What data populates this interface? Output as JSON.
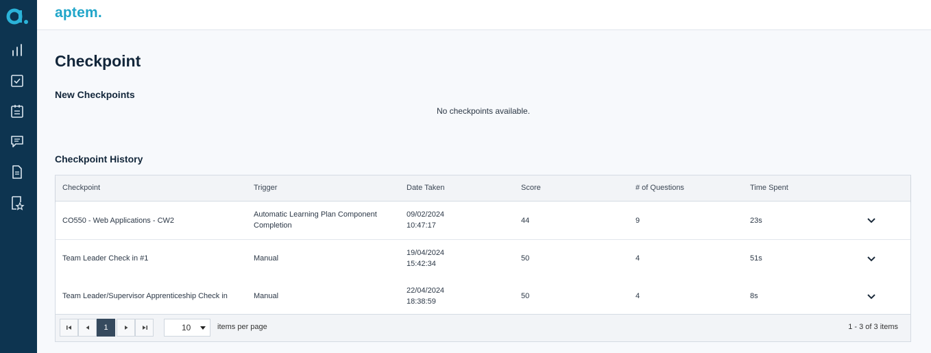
{
  "brand": {
    "name": "aptem."
  },
  "sidebar": {
    "items": [
      {
        "icon": "bar-chart-icon"
      },
      {
        "icon": "checkbox-icon"
      },
      {
        "icon": "clipboard-icon"
      },
      {
        "icon": "chat-icon"
      },
      {
        "icon": "document-icon"
      },
      {
        "icon": "bookmark-star-icon"
      }
    ]
  },
  "page": {
    "title": "Checkpoint",
    "new_section_title": "New Checkpoints",
    "empty_message": "No checkpoints available.",
    "history_section_title": "Checkpoint History"
  },
  "table": {
    "columns": [
      "Checkpoint",
      "Trigger",
      "Date Taken",
      "Score",
      "# of Questions",
      "Time Spent"
    ],
    "rows": [
      {
        "checkpoint": "CO550 - Web Applications - CW2",
        "trigger": "Automatic Learning Plan Component Completion",
        "date": "09/02/2024",
        "time": "10:47:17",
        "score": "44",
        "questions": "9",
        "time_spent": "23s"
      },
      {
        "checkpoint": "Team Leader Check in #1",
        "trigger": "Manual",
        "date": "19/04/2024",
        "time": "15:42:34",
        "score": "50",
        "questions": "4",
        "time_spent": "51s"
      },
      {
        "checkpoint": "Team Leader/Supervisor Apprenticeship Check in",
        "trigger": "Manual",
        "date": "22/04/2024",
        "time": "18:38:59",
        "score": "50",
        "questions": "4",
        "time_spent": "8s"
      }
    ]
  },
  "pager": {
    "current_page": "1",
    "page_size": "10",
    "items_per_page_label": "items per page",
    "range_text": "1 - 3 of 3 items"
  },
  "colors": {
    "sidebar_bg": "#0d3450",
    "brand_accent": "#1fa5c9",
    "active_page": "#364a5e"
  }
}
